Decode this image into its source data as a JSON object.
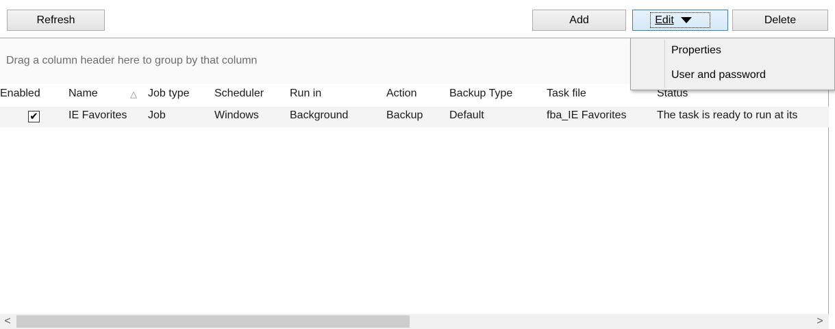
{
  "toolbar": {
    "refresh_label": "Refresh",
    "add_label": "Add",
    "edit_label": "Edit",
    "delete_label": "Delete"
  },
  "edit_menu": {
    "items": [
      "Properties",
      "User and password"
    ]
  },
  "grid": {
    "group_hint": "Drag a column header here to group by that column",
    "sorted_column": "Name",
    "sort_direction": "ascending",
    "columns": [
      "Enabled",
      "Name",
      "Job type",
      "Scheduler",
      "Run in",
      "Action",
      "Backup Type",
      "Task file",
      "Status"
    ],
    "rows": [
      {
        "enabled": true,
        "name": "IE Favorites",
        "job_type": "Job",
        "scheduler": "Windows",
        "run_in": "Background",
        "action": "Backup",
        "backup_type": "Default",
        "task_file": "fba_IE Favorites",
        "status": "The task is ready to run at its"
      }
    ]
  },
  "scrollbar": {
    "left_arrow": "<",
    "right_arrow": ">"
  },
  "colors": {
    "edit_button_accent": "#3c7fb1",
    "row_background": "#f4f4f4",
    "group_hint_text": "#6d6d6d"
  }
}
